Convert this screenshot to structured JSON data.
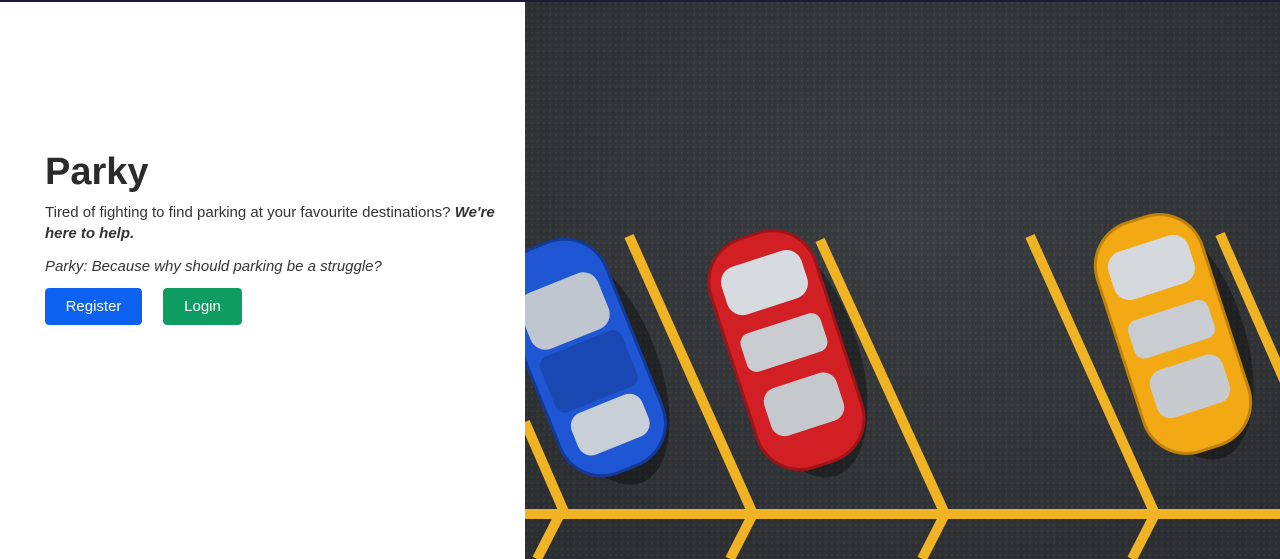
{
  "hero": {
    "title": "Parky",
    "tagline": "Tired of fighting to find parking at your favourite destinations?",
    "tagline_emphasis": "We're here to help.",
    "motto": "Parky: Because why should parking be a struggle?"
  },
  "actions": {
    "register_label": "Register",
    "login_label": "Login"
  },
  "image": {
    "subject": "aerial view of cars in a parking lot",
    "colors": {
      "asphalt": "#3c3f42",
      "lines": "#f0b323",
      "car_blue": "#1f56d4",
      "car_red": "#d11f24",
      "car_yellow": "#f3a913"
    }
  },
  "colors": {
    "register_button": "#0d62f2",
    "login_button": "#0f9d63",
    "title_text": "#2b2b2b"
  }
}
